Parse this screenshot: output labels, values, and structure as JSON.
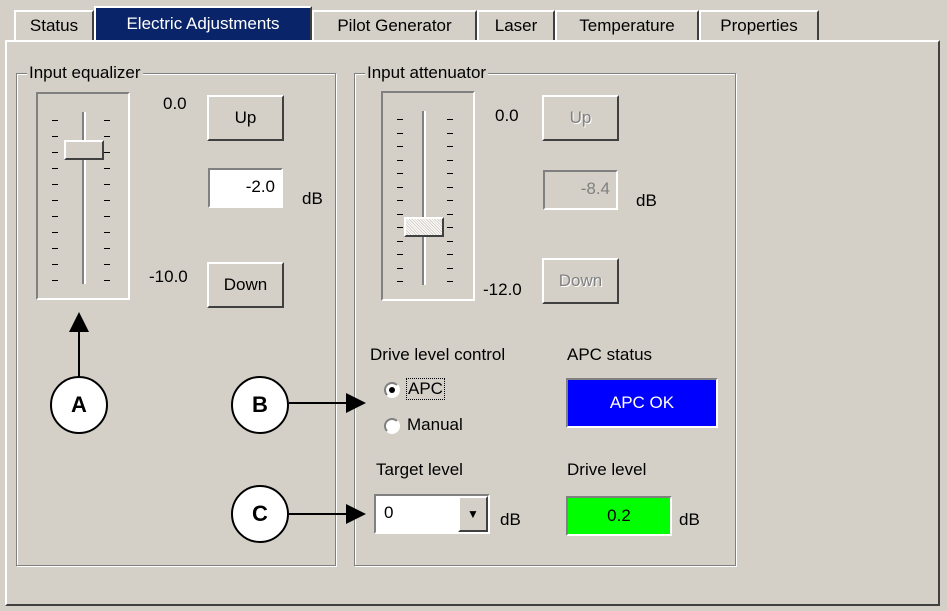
{
  "tabs": [
    {
      "label": "Status"
    },
    {
      "label": "Electric Adjustments"
    },
    {
      "label": "Pilot Generator"
    },
    {
      "label": "Laser"
    },
    {
      "label": "Temperature"
    },
    {
      "label": "Properties"
    }
  ],
  "equalizer": {
    "title": "Input equalizer",
    "max_label": "0.0",
    "min_label": "-10.0",
    "up_label": "Up",
    "down_label": "Down",
    "value": "-2.0",
    "unit": "dB"
  },
  "attenuator": {
    "title": "Input attenuator",
    "max_label": "0.0",
    "min_label": "-12.0",
    "up_label": "Up",
    "down_label": "Down",
    "value": "-8.4",
    "unit": "dB"
  },
  "drive_control": {
    "title": "Drive level control",
    "options": [
      "APC",
      "Manual"
    ],
    "selected": "APC"
  },
  "apc_status": {
    "label": "APC status",
    "value": "APC OK",
    "color": "#0000ff"
  },
  "target_level": {
    "label": "Target level",
    "value": "0",
    "unit": "dB"
  },
  "drive_level": {
    "label": "Drive level",
    "value": "0.2",
    "unit": "dB",
    "color": "#00ff00"
  },
  "callouts": [
    "A",
    "B",
    "C"
  ]
}
